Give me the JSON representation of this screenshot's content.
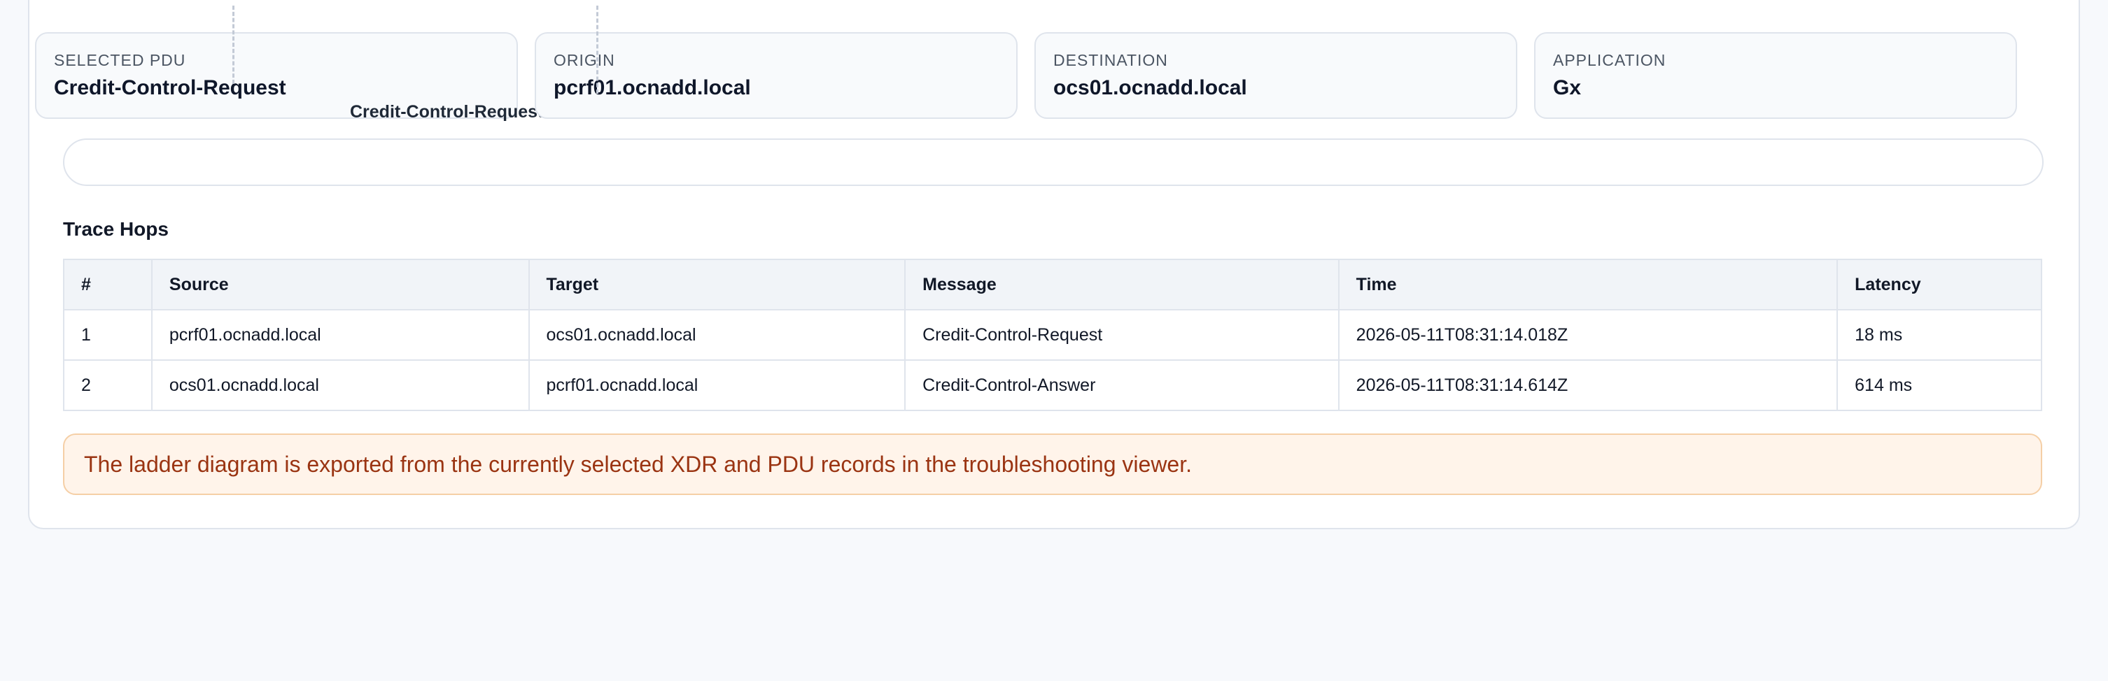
{
  "summary": {
    "selected_pdu": {
      "label": "SELECTED PDU",
      "value": "Credit-Control-Request"
    },
    "origin": {
      "label": "ORIGIN",
      "value": "pcrf01.ocnadd.local"
    },
    "destination": {
      "label": "DESTINATION",
      "value": "ocs01.ocnadd.local"
    },
    "application": {
      "label": "APPLICATION",
      "value": "Gx"
    }
  },
  "ladder": {
    "message_label": "Credit-Control-Request",
    "colors": {
      "lane_dash": "#c3cad6",
      "ghost_left": "#8aa9f0",
      "ghost_right": "#9ca3af"
    }
  },
  "trace": {
    "title": "Trace Hops",
    "columns": [
      "#",
      "Source",
      "Target",
      "Message",
      "Time",
      "Latency"
    ],
    "rows": [
      [
        "1",
        "pcrf01.ocnadd.local",
        "ocs01.ocnadd.local",
        "Credit-Control-Request",
        "2026-05-11T08:31:14.018Z",
        "18 ms"
      ],
      [
        "2",
        "ocs01.ocnadd.local",
        "pcrf01.ocnadd.local",
        "Credit-Control-Answer",
        "2026-05-11T08:31:14.614Z",
        "614 ms"
      ]
    ]
  },
  "notice": {
    "text": "The ladder diagram is exported from the currently selected XDR and PDU records in the troubleshooting viewer.",
    "color": "#9a3412"
  }
}
